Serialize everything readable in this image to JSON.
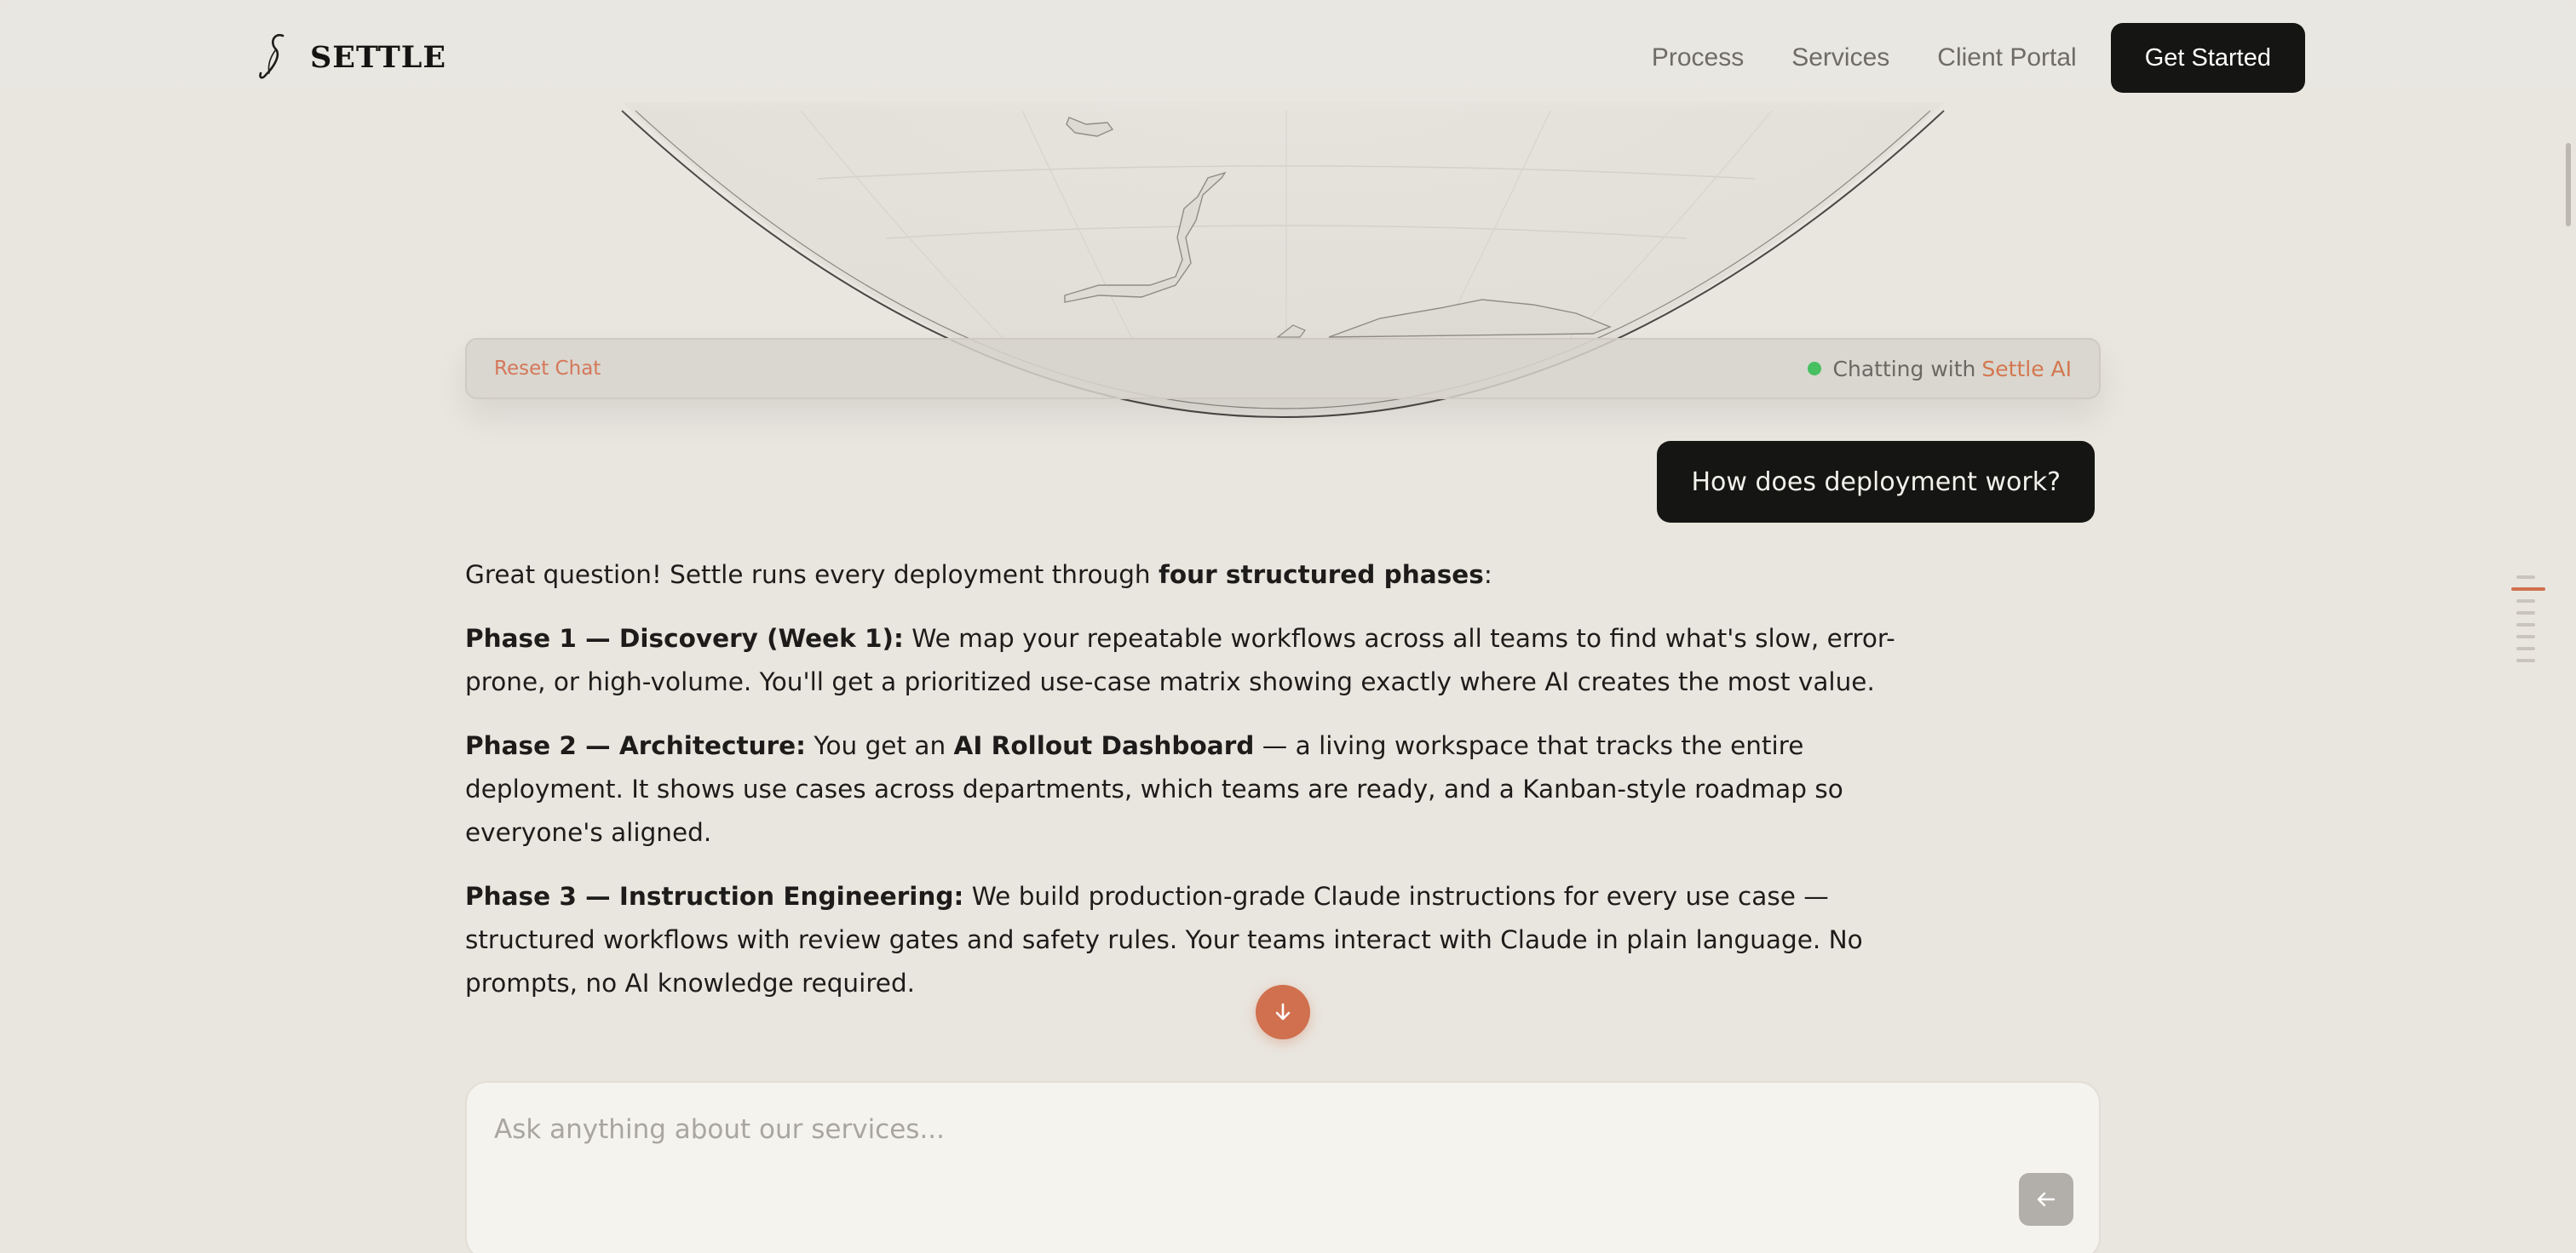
{
  "header": {
    "brand": "SETTLE",
    "nav": [
      "Process",
      "Services",
      "Client Portal"
    ],
    "cta": "Get Started"
  },
  "chat_bar": {
    "reset_label": "Reset Chat",
    "status_prefix": "Chatting with",
    "status_name": "Settle AI",
    "status_color": "#46c061"
  },
  "user_message": "How does deployment work?",
  "assistant": {
    "intro_pre": "Great question! Settle runs every deployment through ",
    "intro_bold": "four structured phases",
    "intro_post": ":",
    "phase1_title": "Phase 1 — Discovery (Week 1):",
    "phase1_text": " We map your repeatable workflows across all teams to find what's slow, error-prone, or high-volume. You'll get a prioritized use-case matrix showing exactly where AI creates the most value.",
    "phase2_title": "Phase 2 — Architecture:",
    "phase2_pre": " You get an ",
    "phase2_bold": "AI Rollout Dashboard",
    "phase2_post": " — a living workspace that tracks the entire deployment. It shows use cases across departments, which teams are ready, and a Kanban-style roadmap so everyone's aligned.",
    "phase3_title": "Phase 3 — Instruction Engineering:",
    "phase3_text": " We build production-grade Claude instructions for every use case — structured workflows with review gates and safety rules. Your teams interact with Claude in plain language. No prompts, no AI knowledge required."
  },
  "input": {
    "placeholder": "Ask anything about our services..."
  },
  "icons": {
    "scroll_down": "arrow-down-icon",
    "send": "arrow-left-icon",
    "logo": "swirl-logo-icon"
  },
  "colors": {
    "accent": "#d0704e",
    "background": "#e9e6df",
    "dark": "#151514"
  }
}
